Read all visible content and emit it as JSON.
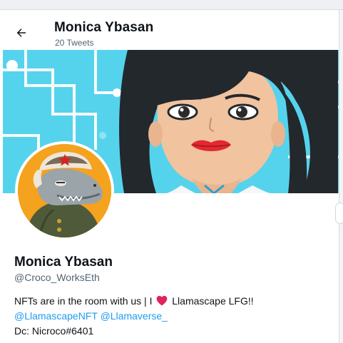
{
  "header": {
    "title": "Monica Ybasan",
    "tweet_count": "20 Tweets"
  },
  "profile": {
    "name": "Monica Ybasan",
    "handle": "@Croco_WorksEth",
    "bio_line1_part1": "NFTs are in the room with us | I",
    "bio_line1_part2": "Llamascape LFG!!",
    "mention1": "@LlamascapeNFT",
    "mention2": "@Llamaverse_",
    "bio_line3": "Dc: Nicroco#6401"
  },
  "icons": {
    "back": "arrow-left-icon",
    "heart": "red-heart-icon"
  },
  "colors": {
    "banner_bg": "#56d3ec",
    "link": "#1d9bf0",
    "heart": "#e0245e",
    "avatar_bg": "#f5a21f"
  }
}
